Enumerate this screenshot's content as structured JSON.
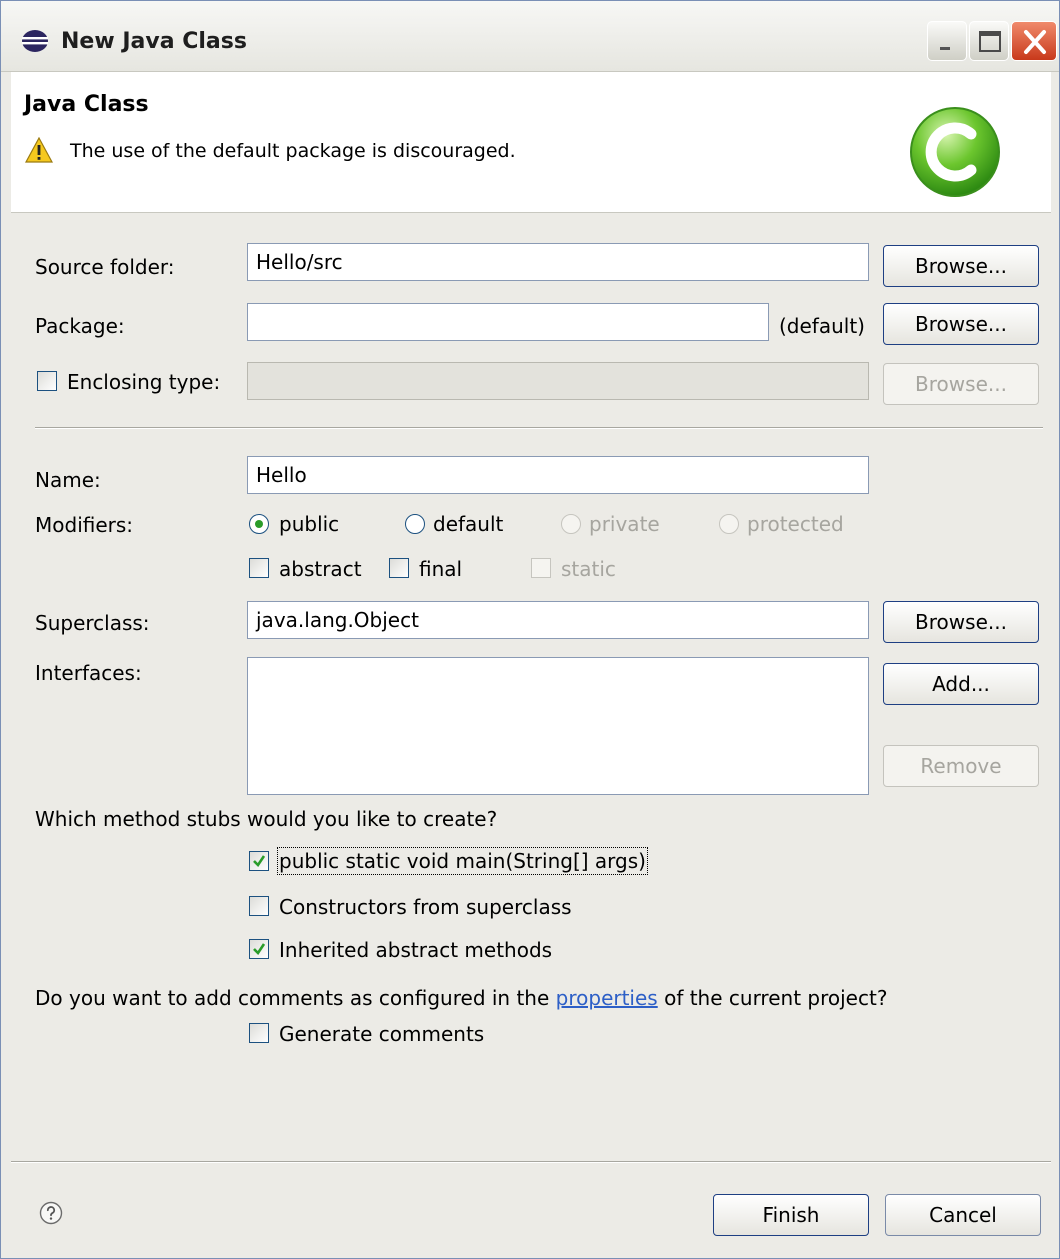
{
  "window": {
    "title": "New Java Class"
  },
  "header": {
    "title": "Java Class",
    "message": "The use of the default package is discouraged."
  },
  "form": {
    "source_folder": {
      "label": "Source folder:",
      "value": "Hello/src",
      "button": "Browse..."
    },
    "package": {
      "label": "Package:",
      "value": "",
      "suffix": "(default)",
      "button": "Browse..."
    },
    "enclosing_type": {
      "label": "Enclosing type:",
      "value": "",
      "button": "Browse...",
      "checked": false
    },
    "name": {
      "label": "Name:",
      "value": "Hello"
    },
    "modifiers": {
      "label": "Modifiers:",
      "access": [
        "public",
        "default",
        "private",
        "protected"
      ],
      "selected": "public",
      "flags": [
        "abstract",
        "final",
        "static"
      ]
    },
    "superclass": {
      "label": "Superclass:",
      "value": "java.lang.Object",
      "button": "Browse..."
    },
    "interfaces": {
      "label": "Interfaces:",
      "add_button": "Add...",
      "remove_button": "Remove",
      "items": []
    },
    "stubs": {
      "question": "Which method stubs would you like to create?",
      "options": [
        {
          "label": "public static void main(String[] args)",
          "checked": true
        },
        {
          "label": "Constructors from superclass",
          "checked": false
        },
        {
          "label": "Inherited abstract methods",
          "checked": true
        }
      ]
    },
    "comments": {
      "question_prefix": "Do you want to add comments as configured in the",
      "link": "properties",
      "question_suffix": "of the current project?",
      "option": {
        "label": "Generate comments",
        "checked": false
      }
    }
  },
  "footer": {
    "finish": "Finish",
    "cancel": "Cancel"
  },
  "icons": {
    "app": "eclipse-icon",
    "warning": "warning-icon",
    "class": "java-class-icon",
    "help": "help-icon"
  },
  "colors": {
    "accent": "#2a9c2a",
    "link": "#2d5fc7",
    "close": "#c8391b"
  }
}
